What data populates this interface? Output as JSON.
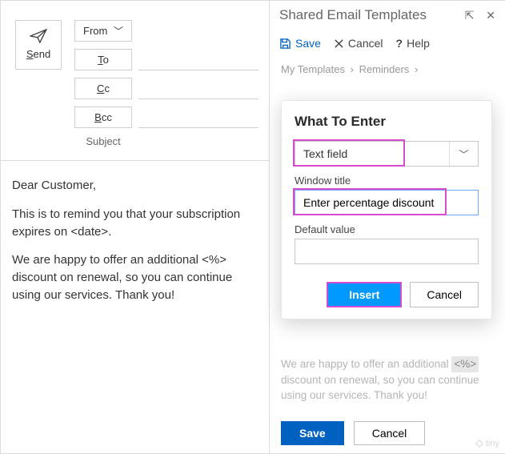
{
  "compose": {
    "send_label": "Send",
    "from_label": "From",
    "to_label": "To",
    "cc_label": "Cc",
    "bcc_label": "Bcc",
    "subject_label": "Subject",
    "body_greeting": "Dear Customer,",
    "body_p1": "This is to remind you that your subscription expires on <date>.",
    "body_p2": "We are happy to offer an additional <%> discount on renewal, so you can continue using our services. Thank you!"
  },
  "panel": {
    "title": "Shared Email Templates",
    "toolbar": {
      "save": "Save",
      "cancel": "Cancel",
      "help": "Help"
    },
    "breadcrumb": [
      "My Templates",
      "Reminders"
    ],
    "preview_snippet_pre": "We are happy to offer an additional ",
    "preview_token": "<%>",
    "preview_snippet_post": " discount on renewal, so you can continue using our services. Thank you!",
    "bottom": {
      "save": "Save",
      "cancel": "Cancel"
    }
  },
  "popover": {
    "heading": "What To Enter",
    "type_value": "Text field",
    "window_title_label": "Window title",
    "window_title_value": "Enter percentage discount",
    "default_value_label": "Default value",
    "default_value": "",
    "insert": "Insert",
    "cancel": "Cancel"
  },
  "watermark": "tiny"
}
